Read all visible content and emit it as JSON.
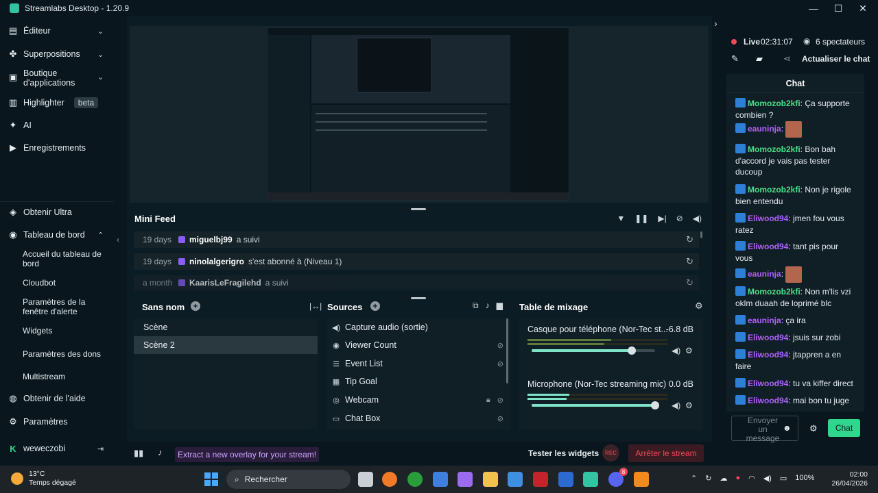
{
  "window": {
    "title": "Streamlabs Desktop - 1.20.9"
  },
  "sidebar": {
    "items": [
      {
        "label": "Éditeur",
        "icon": "layers-icon"
      },
      {
        "label": "Superpositions",
        "icon": "themes-icon"
      },
      {
        "label": "Boutique d'applications",
        "icon": "store-icon"
      },
      {
        "label": "Highlighter",
        "icon": "highlight-icon",
        "badge": "beta"
      },
      {
        "label": "AI",
        "icon": "sparkle-icon"
      },
      {
        "label": "Enregistrements",
        "icon": "play-circle-icon"
      }
    ],
    "bottom": [
      {
        "label": "Obtenir Ultra",
        "icon": "ultra-icon"
      },
      {
        "label": "Tableau de bord",
        "icon": "dashboard-icon"
      }
    ],
    "dashboard_sub": [
      "Accueil du tableau de bord",
      "Cloudbot",
      "Paramètres de la fenêtre d'alerte",
      "Widgets",
      "Paramètres des dons",
      "Multistream"
    ],
    "help": "Obtenir de l'aide",
    "settings": "Paramètres",
    "user": "weweczobi"
  },
  "minifeed": {
    "title": "Mini Feed",
    "rows": [
      {
        "time": "19 days",
        "user": "miguelbj99",
        "action": "a suivi"
      },
      {
        "time": "19 days",
        "user": "ninolalgerigro",
        "action": "s'est abonné à (Niveau 1)"
      },
      {
        "time": "a month",
        "user": "KaarisLeFragilehd",
        "action": "a suivi"
      }
    ]
  },
  "scenes": {
    "title": "Sans nom",
    "items": [
      "Scène",
      "Scène 2"
    ],
    "selected": 1
  },
  "sources": {
    "title": "Sources",
    "items": [
      {
        "label": "Capture audio (sortie)",
        "icon": "speaker-icon"
      },
      {
        "label": "Viewer Count",
        "icon": "eye-icon"
      },
      {
        "label": "Event List",
        "icon": "list-icon"
      },
      {
        "label": "Tip Goal",
        "icon": "goal-icon"
      },
      {
        "label": "Webcam",
        "icon": "webcam-icon"
      },
      {
        "label": "Chat Box",
        "icon": "chat-icon"
      }
    ]
  },
  "mixer": {
    "title": "Table de mixage",
    "channels": [
      {
        "name": "Casque pour téléphone (Nor-Tec st...",
        "db": "-6.8 dB",
        "volume": 0.81
      },
      {
        "name": "Microphone (Nor-Tec streaming mic)",
        "db": "0.0 dB",
        "volume": 1.0
      }
    ]
  },
  "footer": {
    "extract": "Extract a new overlay for your stream!",
    "test": "Tester les widgets",
    "rec": "REC",
    "stop": "Arrêter le stream"
  },
  "live": {
    "label": "Live",
    "time": "02:31:07",
    "viewers": "6 spectateurs",
    "refresh": "Actualiser le chat",
    "accent": "#f0485a"
  },
  "chat": {
    "title": "Chat",
    "messages": [
      {
        "user": "Momozob2kfi",
        "text": "Ça supporte combien ?",
        "color": "#48e08a"
      },
      {
        "user": "eauninja",
        "text": "",
        "emote": true,
        "color": "#b060ff"
      },
      {
        "user": "Momozob2kfi",
        "text": "Bon bah d'accord je vais pas tester ducoup",
        "color": "#48e08a"
      },
      {
        "user": "Momozob2kfi",
        "text": "Non je rigole bien entendu",
        "color": "#48e08a"
      },
      {
        "user": "Eliwood94",
        "text": "jmen fou vous ratez",
        "color": "#b060ff"
      },
      {
        "user": "Eliwood94",
        "text": "tant pis pour vous",
        "color": "#b060ff"
      },
      {
        "user": "eauninja",
        "text": "",
        "emote": true,
        "color": "#b060ff"
      },
      {
        "user": "Momozob2kfi",
        "text": "Non m'lis vzi oklm duaah de loprimé blc",
        "color": "#48e08a"
      },
      {
        "user": "eauninja",
        "text": "ça ira",
        "color": "#b060ff"
      },
      {
        "user": "Eliwood94",
        "text": "jsuis sur zobi",
        "color": "#b060ff"
      },
      {
        "user": "Eliwood94",
        "text": "jtappren a en faire",
        "color": "#b060ff"
      },
      {
        "user": "Eliwood94",
        "text": "tu va kiffer direct",
        "color": "#b060ff"
      },
      {
        "user": "Eliwood94",
        "text": "mai bon tu juge",
        "color": "#b060ff"
      }
    ],
    "input_placeholder": "Envoyer un message",
    "send": "Chat"
  },
  "taskbar": {
    "temp": "13°C",
    "weather": "Temps dégagé",
    "search": "Rechercher",
    "battery": "100%",
    "time": "02:00",
    "date": "26/04/2026",
    "notif": "8"
  }
}
